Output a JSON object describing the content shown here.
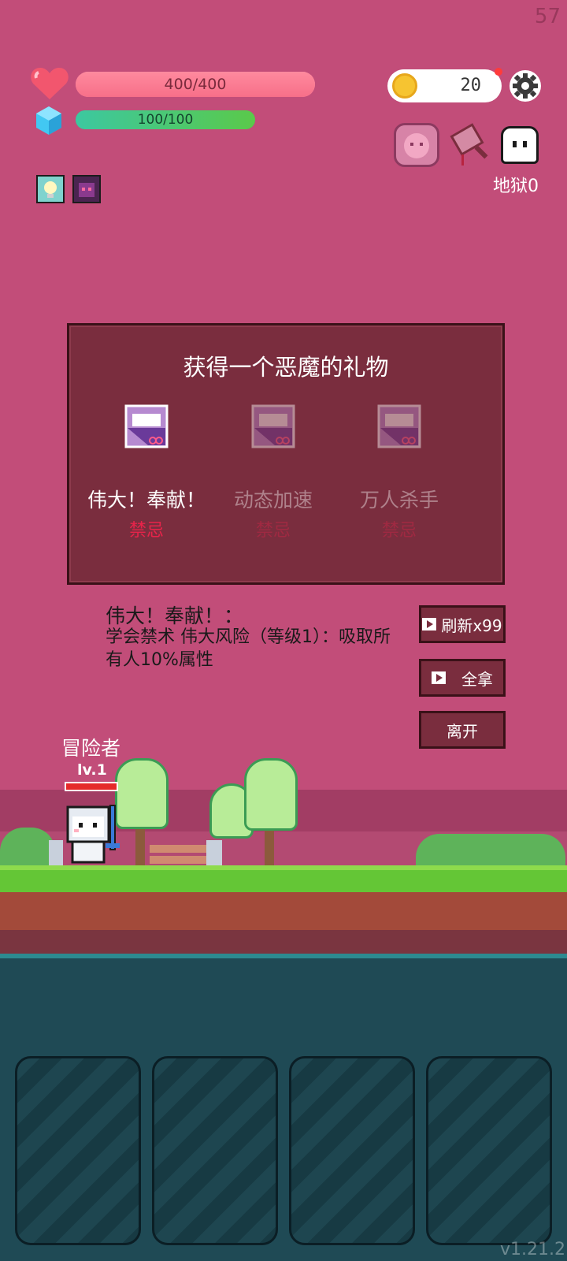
{
  "fps": "57",
  "player": {
    "hp_text": "400/400",
    "hp_fraction": 1.0,
    "mp_text": "100/100",
    "mp_fraction": 1.0
  },
  "coins": "20",
  "hell_label": "地狱0",
  "dialog": {
    "title": "获得一个恶魔的礼物",
    "gifts": [
      {
        "name": "伟大！奉献！",
        "state": "禁忌",
        "selected": true
      },
      {
        "name": "动态加速",
        "state": "禁忌",
        "selected": false
      },
      {
        "name": "万人杀手",
        "state": "禁忌",
        "selected": false
      }
    ]
  },
  "description": {
    "title": "伟大！奉献！：",
    "body": "学会禁术 伟大风险（等级1）：吸取所有人10%属性"
  },
  "buttons": {
    "refresh": "刷新x99",
    "take_all": "全拿",
    "leave": "离开"
  },
  "hero": {
    "name": "冒险者",
    "level": "lv.1",
    "hp_fraction": 1.0
  },
  "version": "v1.21.2",
  "colors": {
    "background": "#c24d79",
    "dialog": "#7a2d3e",
    "forbidden": "#e8234a"
  },
  "icons": {
    "hp": "heart-icon",
    "mp": "gem-icon",
    "coin": "coin-icon",
    "settings": "gear-icon",
    "gift": "gift-card-icon"
  }
}
